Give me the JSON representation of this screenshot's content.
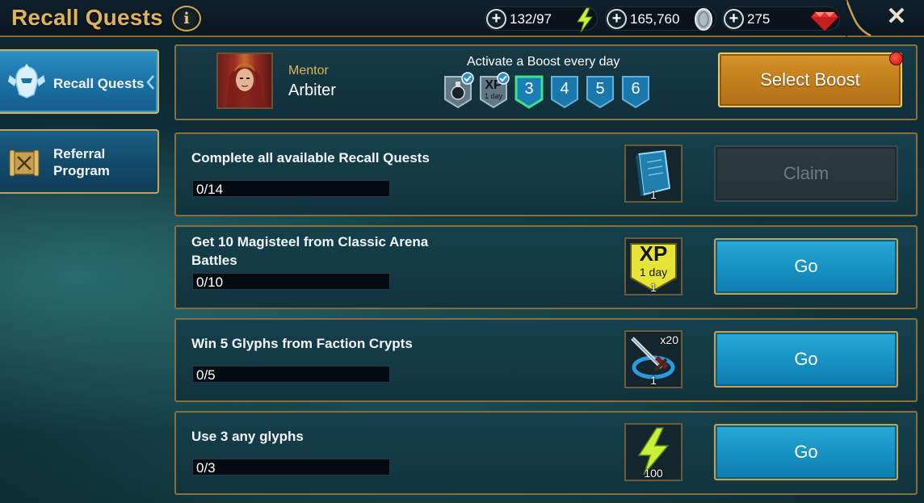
{
  "header": {
    "title": "Recall Quests",
    "info_icon": "i",
    "resources": [
      {
        "name": "energy",
        "value": "132/97",
        "icon": "lightning-icon",
        "color": "#c8f03a"
      },
      {
        "name": "silver",
        "value": "165,760",
        "icon": "silver-coin-icon",
        "color": "#c9d3da"
      },
      {
        "name": "gems",
        "value": "275",
        "icon": "ruby-icon",
        "color": "#e8322e"
      }
    ],
    "plus": "+",
    "close": "✕"
  },
  "sidebar": {
    "items": [
      {
        "label": "Recall Quests",
        "active": true,
        "icon": "helmet-emblem-icon"
      },
      {
        "label": "Referral Program",
        "active": false,
        "icon": "scroll-banner-icon"
      }
    ]
  },
  "mentor": {
    "kicker": "Mentor",
    "name": "Arbiter",
    "boost_caption": "Activate a Boost every day",
    "boost_days": [
      {
        "label": "",
        "icon": "potion-icon",
        "claimed": true
      },
      {
        "label": "XP",
        "sublabel": "1 day",
        "icon": "xp-boost-icon",
        "claimed": true
      },
      {
        "label": "3",
        "current": true
      },
      {
        "label": "4"
      },
      {
        "label": "5"
      },
      {
        "label": "6"
      }
    ],
    "select_boost_label": "Select Boost",
    "notification": true
  },
  "quests": [
    {
      "title": "Complete all available Recall Quests",
      "progress": "0/14",
      "progress_fraction": 0,
      "reward": {
        "icon": "blue-tome-icon",
        "count": "1"
      },
      "action": "Claim",
      "action_enabled": false
    },
    {
      "title": "Get 10 Magisteel from Classic Arena Battles",
      "progress": "0/10",
      "progress_fraction": 0,
      "reward": {
        "icon": "xp-boost-icon",
        "label": "XP",
        "sublabel": "1 day",
        "count": "1"
      },
      "action": "Go",
      "action_enabled": true
    },
    {
      "title": "Win 5 Glyphs from Faction Crypts",
      "progress": "0/5",
      "progress_fraction": 0,
      "reward": {
        "icon": "sword-portal-icon",
        "multiplier": "x20",
        "count": "1"
      },
      "action": "Go",
      "action_enabled": true
    },
    {
      "title": "Use 3 any glyphs",
      "progress": "0/3",
      "progress_fraction": 0,
      "reward": {
        "icon": "lightning-icon",
        "count": "100"
      },
      "action": "Go",
      "action_enabled": true
    }
  ]
}
